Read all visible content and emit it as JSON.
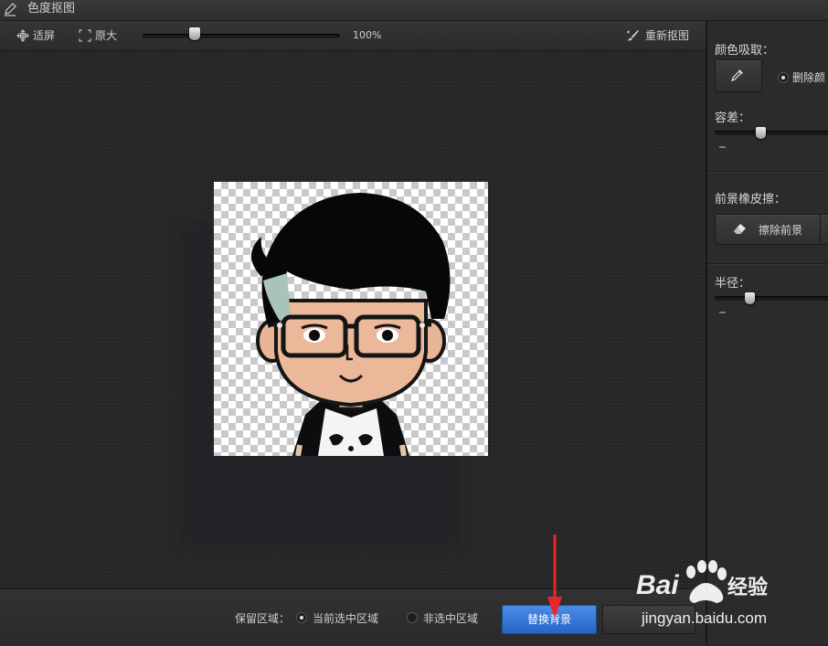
{
  "window": {
    "title": "色度抠图"
  },
  "toolbar": {
    "fit_label": "适屏",
    "original_label": "原大",
    "zoom_value": "100%",
    "zoom_percent": 100,
    "redo_label": "重新抠图"
  },
  "panel": {
    "color_pick_label": "颜色吸取：",
    "delete_color_label": "删除颜",
    "tolerance_label": "容差：",
    "tolerance_level": 0.38,
    "foreground_eraser_label": "前景橡皮擦：",
    "erase_foreground_label": "擦除前景",
    "radius_label": "半径：",
    "radius_level": 0.28
  },
  "bottom": {
    "keep_area_label": "保留区域：",
    "current_selection_label": "当前选中区域",
    "non_selection_label": "非选中区域",
    "replace_bg_label": "替换背景"
  },
  "watermark": {
    "brand": "Baidu经验",
    "url": "jingyan.baidu.com"
  },
  "colors": {
    "primary_button": "#2f6fd1",
    "annotation_arrow": "#e8262a"
  }
}
